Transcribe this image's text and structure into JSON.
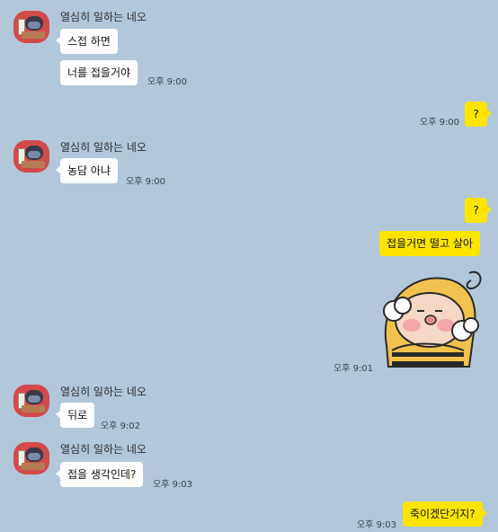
{
  "messages": {
    "g1": {
      "sender": "열심히 일하는 네오",
      "bubble1": "스접 하면",
      "bubble2": "너를 접을거야",
      "time": "오후 9:00"
    },
    "m1": {
      "text": "?",
      "time": "오후 9:00"
    },
    "g2": {
      "sender": "열심히 일하는 네오",
      "bubble1": "농담 아냐",
      "time": "오후 9:00"
    },
    "m2": {
      "text": "?",
      "text2": "접을거면 떨고 살아"
    },
    "sticker": {
      "name": "sticker-character-icon",
      "time": "오후 9:01"
    },
    "g3": {
      "sender": "열심히 일하는 네오",
      "bubble1": "뒤로",
      "time": "오후 9:02"
    },
    "g4": {
      "sender": "열심히 일하는 네오",
      "bubble1": "접을 생각인데?",
      "time": "오후 9:03"
    },
    "m3": {
      "text": "죽이겠단거지?",
      "time": "오후 9:03"
    }
  },
  "colors": {
    "background": "#b2c7da",
    "own_bubble": "#fee500",
    "other_bubble": "#ffffff"
  }
}
